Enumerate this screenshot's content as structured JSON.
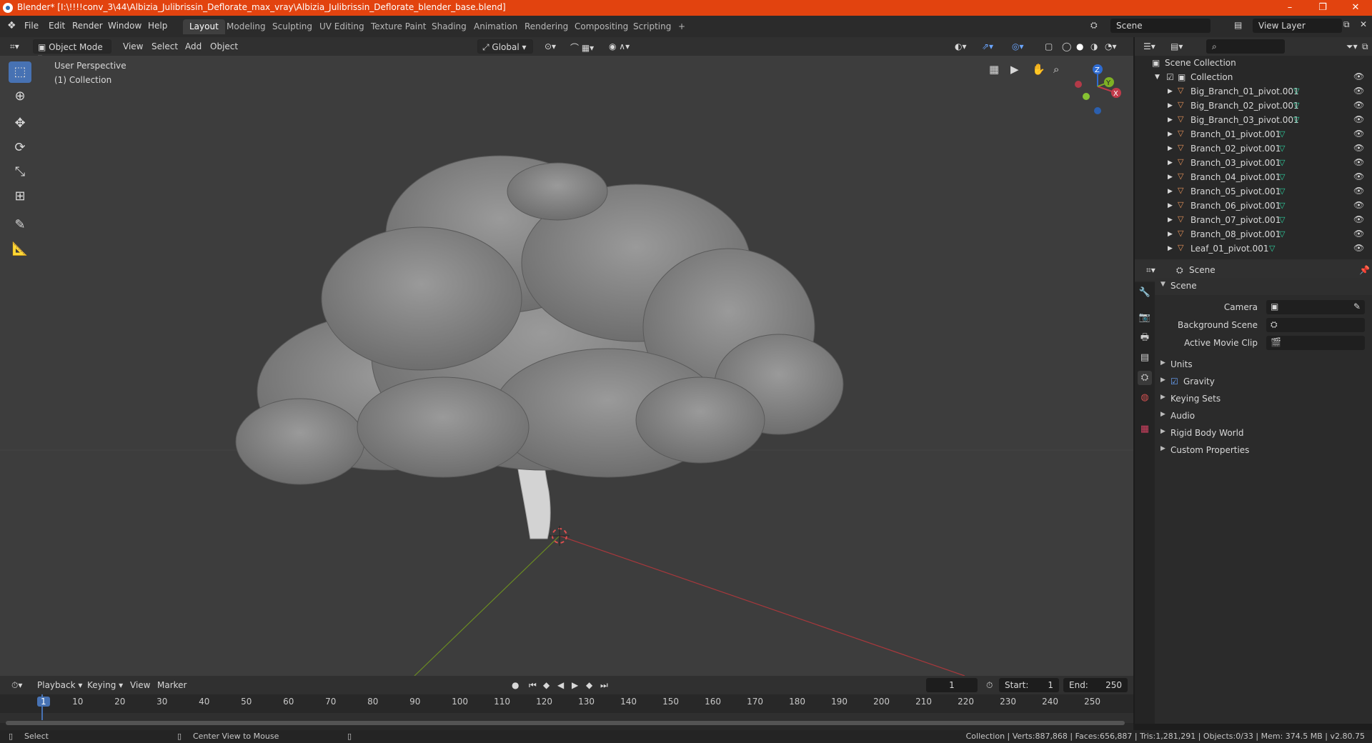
{
  "titlebar": {
    "title": "Blender* [I:\\!!!!conv_3\\44\\Albizia_Julibrissin_Deflorate_max_vray\\Albizia_Julibrissin_Deflorate_blender_base.blend]",
    "min": "–",
    "max": "❐",
    "close": "✕"
  },
  "menu": [
    "File",
    "Edit",
    "Render",
    "Window",
    "Help"
  ],
  "workspaces": [
    "Layout",
    "Modeling",
    "Sculpting",
    "UV Editing",
    "Texture Paint",
    "Shading",
    "Animation",
    "Rendering",
    "Compositing",
    "Scripting"
  ],
  "workspace_add": "+",
  "scene_field": "Scene",
  "view_layer_field": "View Layer",
  "viewport_header": {
    "mode": "Object Mode",
    "view": "View",
    "select": "Select",
    "add": "Add",
    "object": "Object",
    "orientation": "Global"
  },
  "viewport": {
    "perspective": "User Perspective",
    "collection": "(1) Collection",
    "gizmo_x": "X",
    "gizmo_y": "Y",
    "gizmo_z": "Z"
  },
  "outliner": {
    "scene_collection": "Scene Collection",
    "collection": "Collection",
    "items": [
      "Big_Branch_01_pivot.001",
      "Big_Branch_02_pivot.001",
      "Big_Branch_03_pivot.001",
      "Branch_01_pivot.001",
      "Branch_02_pivot.001",
      "Branch_03_pivot.001",
      "Branch_04_pivot.001",
      "Branch_05_pivot.001",
      "Branch_06_pivot.001",
      "Branch_07_pivot.001",
      "Branch_08_pivot.001",
      "Leaf_01_pivot.001"
    ]
  },
  "properties": {
    "header": "Scene",
    "section": "Scene",
    "camera": "Camera",
    "background_scene": "Background Scene",
    "active_movie_clip": "Active Movie Clip",
    "subsections": [
      "Units",
      "Gravity",
      "Keying Sets",
      "Audio",
      "Rigid Body World",
      "Custom Properties"
    ]
  },
  "timeline": {
    "playback": "Playback",
    "keying": "Keying",
    "view": "View",
    "marker": "Marker",
    "current_frame": "1",
    "start_label": "Start:",
    "start": "1",
    "end_label": "End:",
    "end": "250",
    "ticks": [
      "1",
      "10",
      "20",
      "30",
      "40",
      "50",
      "60",
      "70",
      "80",
      "90",
      "100",
      "110",
      "120",
      "130",
      "140",
      "150",
      "160",
      "170",
      "180",
      "190",
      "200",
      "210",
      "220",
      "230",
      "240",
      "250"
    ]
  },
  "statusbar": {
    "select": "Select",
    "center_view": "Center View to Mouse",
    "stats": "Collection | Verts:887,868 | Faces:656,887 | Tris:1,281,291 | Objects:0/33 | Mem: 374.5 MB | v2.80.75"
  },
  "colors": {
    "titlebar": "#e2430f",
    "active_tool": "#4772b3",
    "x_axis": "#a8383c",
    "y_axis": "#6b8c21",
    "mesh_icon": "#2ecf9f",
    "object_icon": "#e8935a"
  }
}
